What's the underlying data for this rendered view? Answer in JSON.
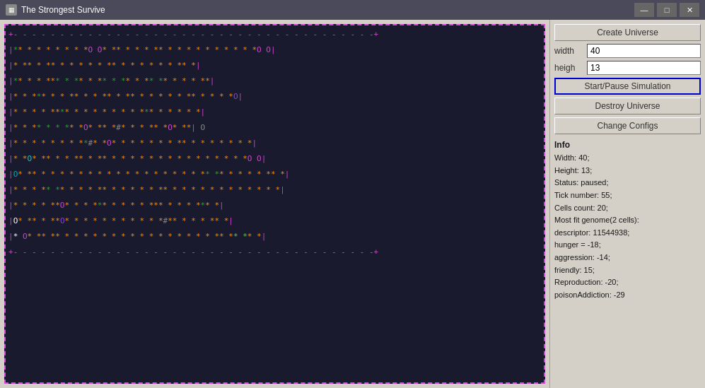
{
  "window": {
    "title": "The Strongest Survive",
    "icon_label": "SS"
  },
  "titlebar": {
    "minimize": "—",
    "maximize": "□",
    "close": "✕"
  },
  "right_panel": {
    "create_universe_label": "Create Universe",
    "width_label": "width",
    "width_value": "40",
    "height_label": "heigh",
    "height_value": "13",
    "start_pause_label": "Start/Pause Simulation",
    "destroy_label": "Destroy Universe",
    "change_configs_label": "Change Configs",
    "info_title": "Info",
    "info_lines": [
      "Width: 40;",
      "Height: 13;",
      "Status: paused;",
      "Tick number: 55;",
      "Cells count: 20;",
      "Most fit genome(2 cells):",
      "   descriptor: 11544938;",
      "   hunger = -18;",
      "   aggression: -14;",
      "   friendly: 15;",
      "   Reproduction: -20;",
      "   poisonAddiction: -29"
    ]
  }
}
